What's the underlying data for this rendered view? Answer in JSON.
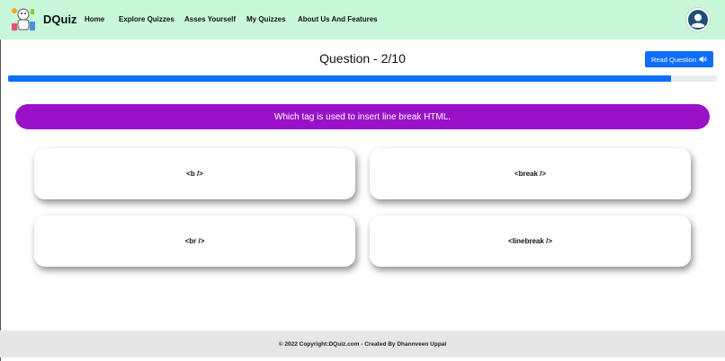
{
  "header": {
    "brand": "DQuiz",
    "nav": [
      "Home",
      "Explore Quizzes",
      "Asses Yourself",
      "My Quizzes",
      "About Us And Features"
    ],
    "logo_icon": "quiz-mascot-icon",
    "profile_icon": "user-avatar-icon"
  },
  "quiz": {
    "title": "Question - 2/10",
    "read_button_label": "Read Question",
    "read_button_icon": "speaker-icon",
    "progress_fraction": 0.935,
    "question": "Which tag is used to insert line break HTML.",
    "options": [
      "<b />",
      "<break />",
      "<br />",
      "<linebreak />"
    ]
  },
  "footer": {
    "text": "© 2022 Copyright:DQuiz.com - Created By Dhannveen Uppal"
  },
  "colors": {
    "navbar_bg": "#c9f7d9",
    "accent_blue": "#0d6efd",
    "question_banner": "#9b11c9",
    "footer_bg": "#e6e6e6"
  }
}
